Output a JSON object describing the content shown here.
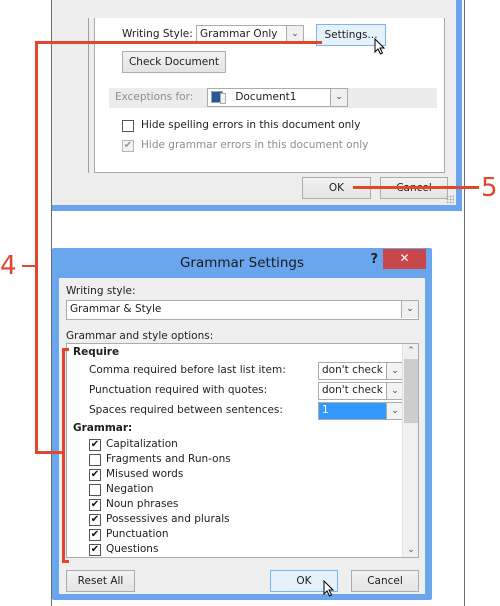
{
  "proofing_dialog": {
    "writing_style_label": "Writing Style:",
    "writing_style_value": "Grammar Only",
    "settings_button": "Settings...",
    "check_document_button": "Check Document",
    "exceptions_label": "Exceptions for:",
    "exceptions_value": "Document1",
    "hide_spelling_label": "Hide spelling errors in this document only",
    "hide_spelling_checked": false,
    "hide_grammar_label": "Hide grammar errors in this document only",
    "hide_grammar_checked": true,
    "ok_button": "OK",
    "cancel_button": "Cancel"
  },
  "grammar_dialog": {
    "title": "Grammar Settings",
    "help_icon": "?",
    "close_icon": "✕",
    "writing_style_label": "Writing style:",
    "writing_style_value": "Grammar & Style",
    "options_label": "Grammar and style options:",
    "require_header": "Require",
    "require_items": [
      {
        "label": "Comma required before last list item:",
        "value": "don't check"
      },
      {
        "label": "Punctuation required with quotes:",
        "value": "don't check"
      },
      {
        "label": "Spaces required between sentences:",
        "value": "1"
      }
    ],
    "grammar_header": "Grammar:",
    "grammar_items": [
      {
        "label": "Capitalization",
        "checked": true
      },
      {
        "label": "Fragments and Run-ons",
        "checked": false
      },
      {
        "label": "Misused words",
        "checked": true
      },
      {
        "label": "Negation",
        "checked": false
      },
      {
        "label": "Noun phrases",
        "checked": true
      },
      {
        "label": "Possessives and plurals",
        "checked": true
      },
      {
        "label": "Punctuation",
        "checked": true
      },
      {
        "label": "Questions",
        "checked": true
      }
    ],
    "reset_all_button": "Reset All",
    "ok_button": "OK",
    "cancel_button": "Cancel"
  },
  "callouts": {
    "step4": "4",
    "step5": "5",
    "color": "#e2462d"
  },
  "glyphs": {
    "chevron_down": "⌄",
    "chevron_up": "⌃",
    "check": "✔"
  }
}
